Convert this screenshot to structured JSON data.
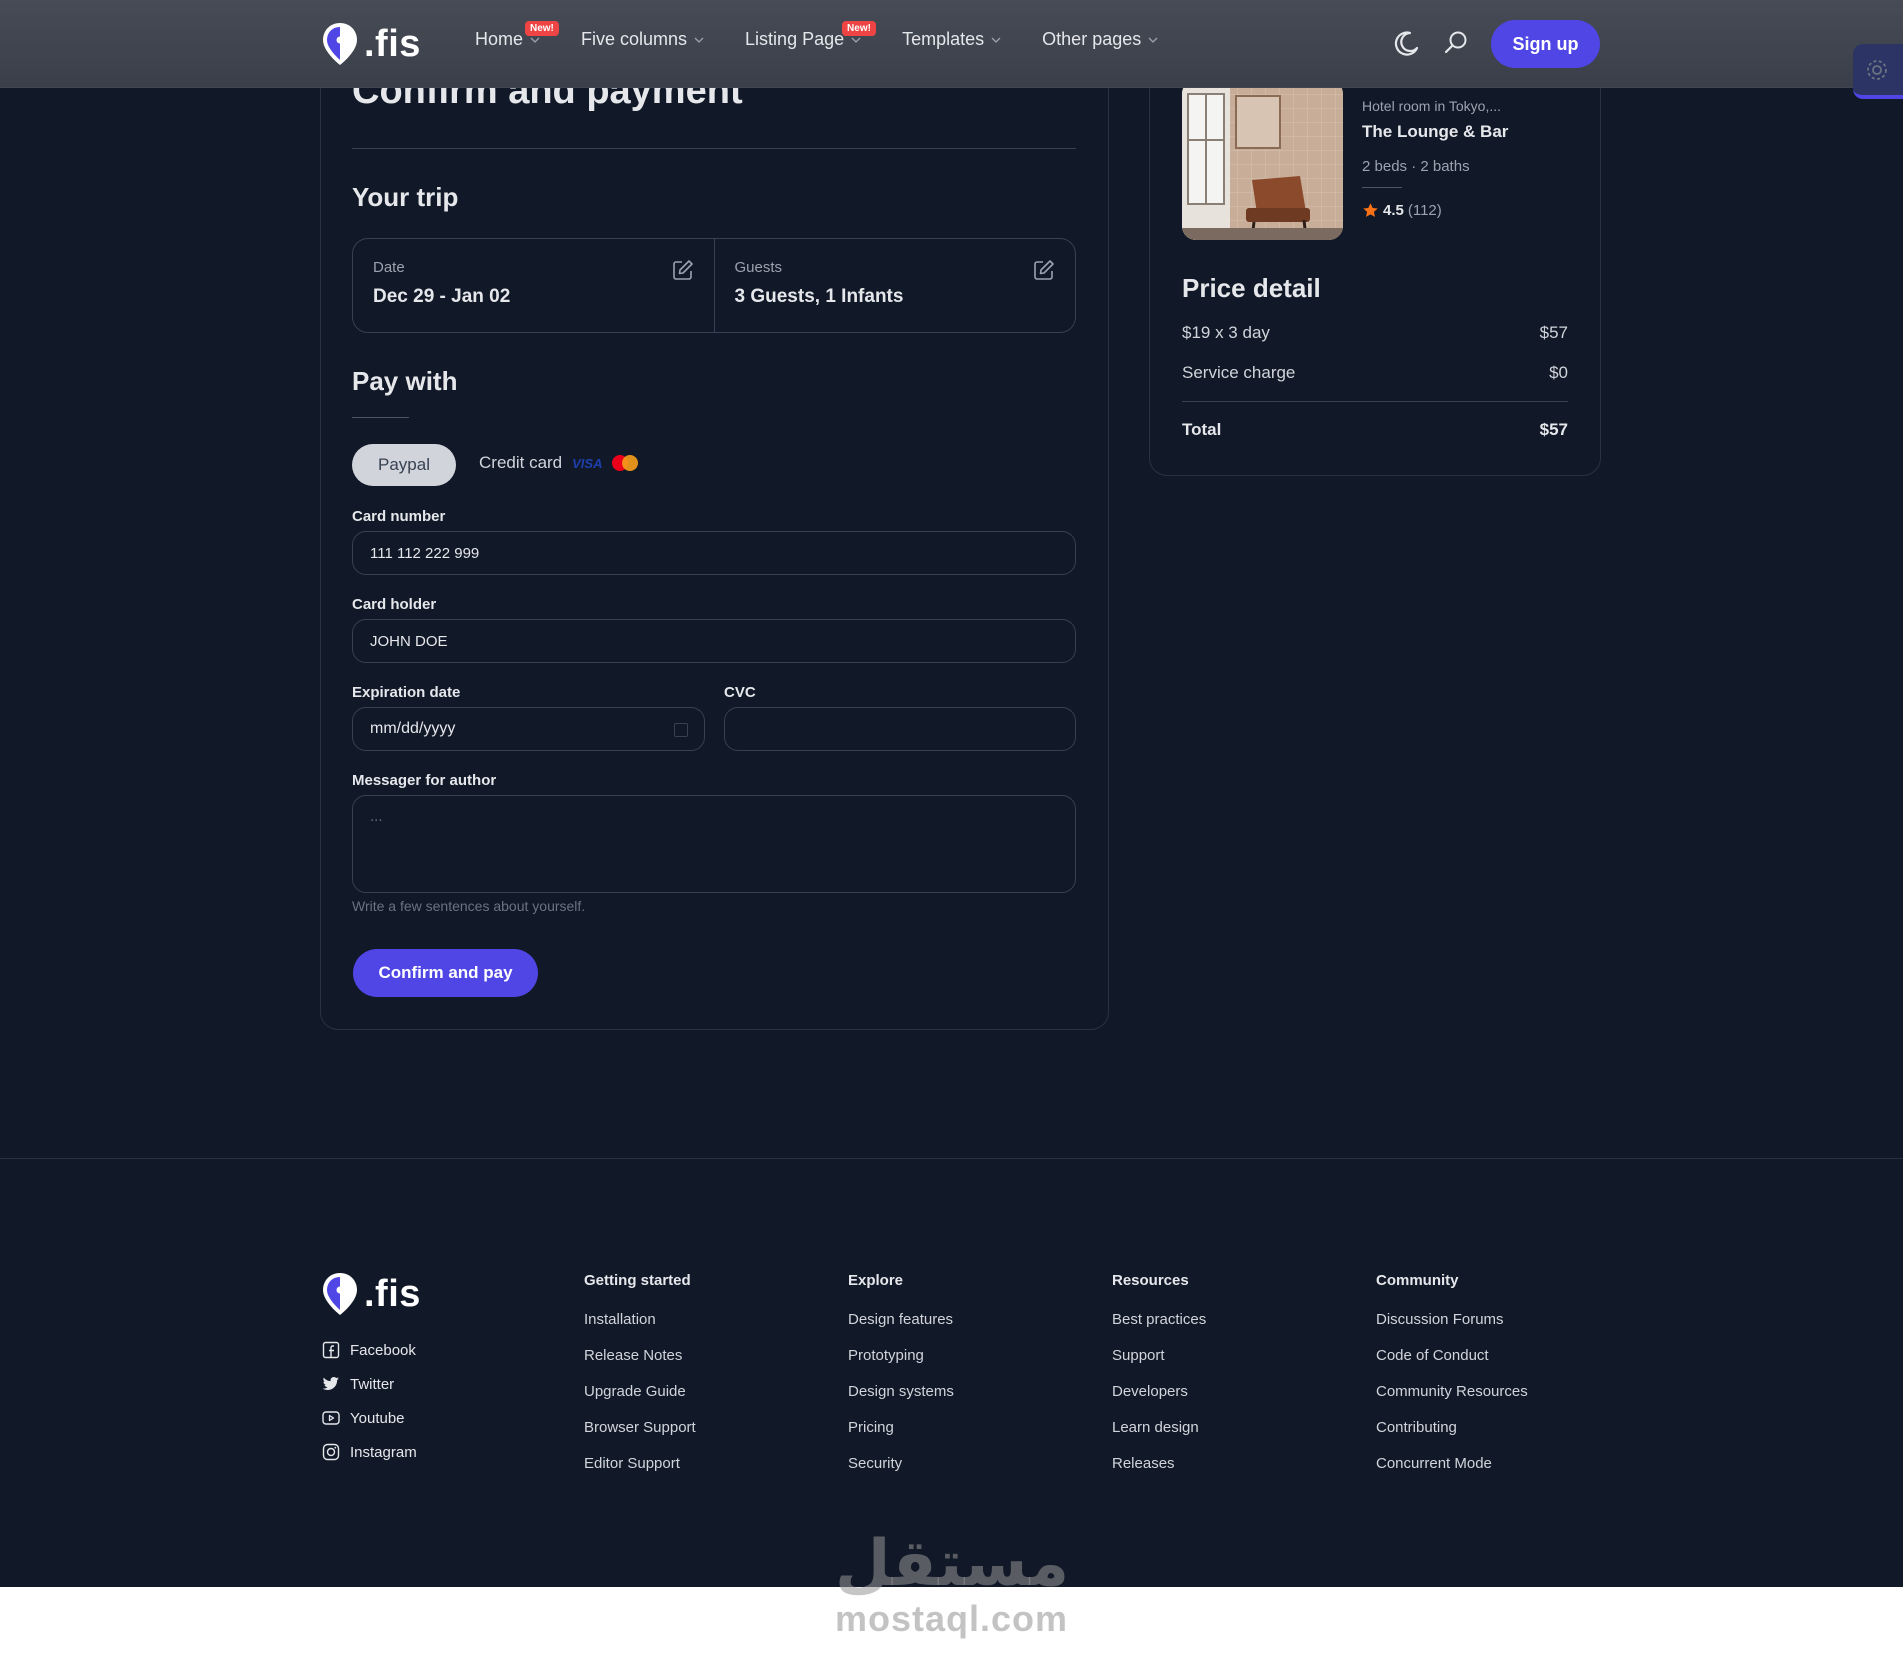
{
  "brand": {
    "name": ".fis"
  },
  "nav": {
    "items": [
      {
        "label": "Home",
        "badge": "New!"
      },
      {
        "label": "Five columns",
        "badge": ""
      },
      {
        "label": "Listing Page",
        "badge": "New!"
      },
      {
        "label": "Templates",
        "badge": ""
      },
      {
        "label": "Other pages",
        "badge": ""
      }
    ],
    "signup_label": "Sign up"
  },
  "main": {
    "title": "Confirm and payment",
    "trip_title": "Your trip",
    "date_label": "Date",
    "date_value": "Dec 29 - Jan 02",
    "guests_label": "Guests",
    "guests_value": "3 Guests, 1 Infants",
    "pay_with_title": "Pay with",
    "tab_paypal": "Paypal",
    "tab_credit": "Credit card",
    "visa_text": "VISA",
    "card_number_label": "Card number",
    "card_number_value": "111 112 222 999",
    "card_holder_label": "Card holder",
    "card_holder_value": "JOHN DOE",
    "expiration_label": "Expiration date",
    "expiration_placeholder": "mm/dd/yyyy",
    "cvc_label": "CVC",
    "cvc_value": "",
    "message_label": "Messager for author",
    "message_placeholder": "...",
    "message_hint": "Write a few sentences about yourself.",
    "confirm_button": "Confirm and pay"
  },
  "listing": {
    "subtitle": "Hotel room in Tokyo,...",
    "name": "The Lounge & Bar",
    "meta": "2 beds · 2 baths",
    "rating": "4.5",
    "reviews": "(112)"
  },
  "price": {
    "title": "Price detail",
    "rows": [
      {
        "label": "$19 x 3 day",
        "value": "$57"
      },
      {
        "label": "Service charge",
        "value": "$0"
      }
    ],
    "total_label": "Total",
    "total_value": "$57"
  },
  "footer": {
    "social": [
      "Facebook",
      "Twitter",
      "Youtube",
      "Instagram"
    ],
    "columns": [
      {
        "title": "Getting started",
        "links": [
          "Installation",
          "Release Notes",
          "Upgrade Guide",
          "Browser Support",
          "Editor Support"
        ]
      },
      {
        "title": "Explore",
        "links": [
          "Design features",
          "Prototyping",
          "Design systems",
          "Pricing",
          "Security"
        ]
      },
      {
        "title": "Resources",
        "links": [
          "Best practices",
          "Support",
          "Developers",
          "Learn design",
          "Releases"
        ]
      },
      {
        "title": "Community",
        "links": [
          "Discussion Forums",
          "Code of Conduct",
          "Community Resources",
          "Contributing",
          "Concurrent Mode"
        ]
      }
    ]
  },
  "watermark": {
    "arabic": "مستقل",
    "latin": "mostaql.com"
  },
  "colors": {
    "background": "#111827",
    "accent": "#4f46e5",
    "badge": "#ef4444",
    "star": "#f97316",
    "header": "#474b55"
  },
  "icons": [
    "map-pin-logo-icon",
    "chevron-down-icon",
    "moon-icon",
    "search-icon",
    "gear-icon",
    "edit-icon",
    "calendar-icon",
    "star-icon",
    "facebook-icon",
    "twitter-icon",
    "youtube-icon",
    "instagram-icon"
  ]
}
